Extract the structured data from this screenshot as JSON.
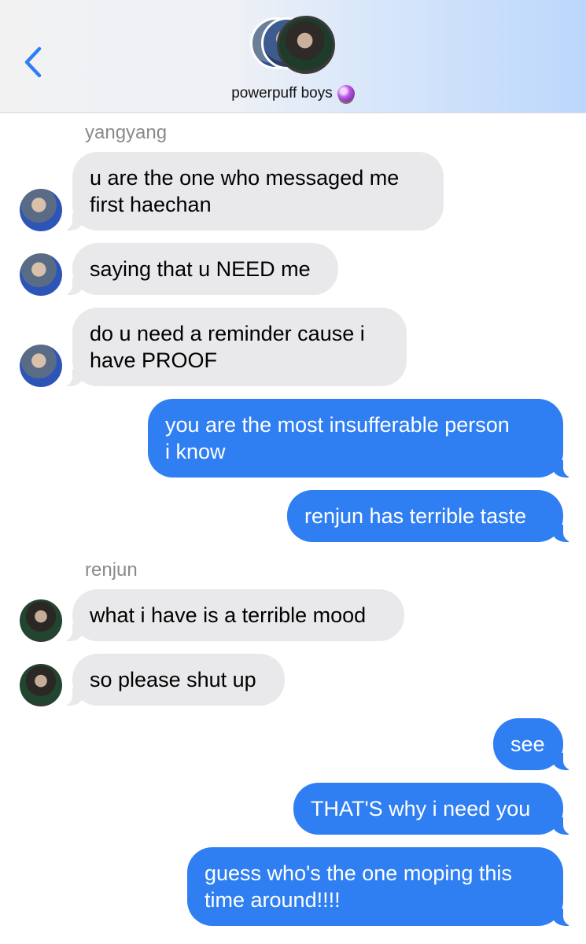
{
  "header": {
    "title": "powerpuff boys",
    "title_emoji": "crystal-ball-icon",
    "back_icon": "chevron-left-icon",
    "accent_color": "#2f7ff2"
  },
  "conversation": {
    "senders": {
      "yangyang": "yangyang",
      "renjun": "renjun"
    },
    "messages": [
      {
        "from": "yangyang",
        "direction": "incoming",
        "text": "u are the one who messaged me\nfirst haechan"
      },
      {
        "from": "yangyang",
        "direction": "incoming",
        "text": "saying that u NEED me"
      },
      {
        "from": "yangyang",
        "direction": "incoming",
        "text": "do u need a reminder cause i\nhave PROOF"
      },
      {
        "from": "me",
        "direction": "outgoing",
        "text": "you are the most insufferable person\ni know"
      },
      {
        "from": "me",
        "direction": "outgoing",
        "text": "renjun has terrible taste"
      },
      {
        "from": "renjun",
        "direction": "incoming",
        "text": "what i have is a terrible mood"
      },
      {
        "from": "renjun",
        "direction": "incoming",
        "text": "so please shut up"
      },
      {
        "from": "me",
        "direction": "outgoing",
        "text": "see"
      },
      {
        "from": "me",
        "direction": "outgoing",
        "text": "THAT'S why i need you"
      },
      {
        "from": "me",
        "direction": "outgoing",
        "text": "guess who's the one moping this\ntime around!!!!"
      }
    ]
  },
  "colors": {
    "incoming_bubble": "#e9e9eb",
    "outgoing_bubble": "#2f7ff2",
    "sender_label": "#8a8a8e"
  }
}
